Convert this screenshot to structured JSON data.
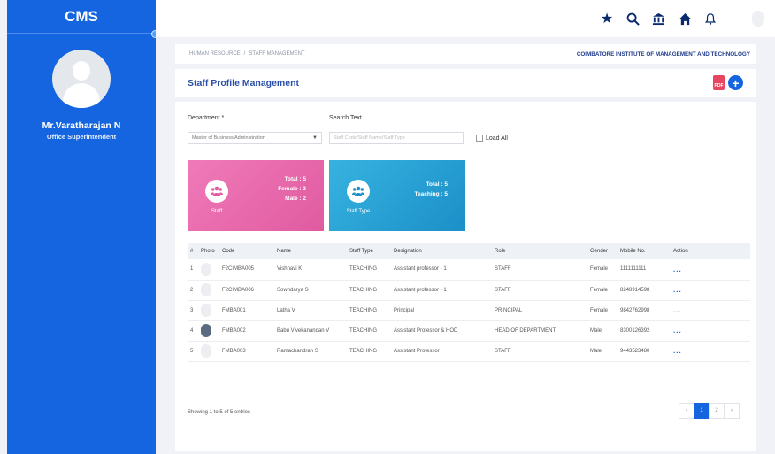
{
  "app": {
    "logo": "CMS"
  },
  "user": {
    "name": "Mr.Varatharajan N",
    "role": "Office Superintendent"
  },
  "topbar_icons": [
    "star-icon",
    "search-icon",
    "bank-icon",
    "home-icon",
    "bell-icon"
  ],
  "breadcrumb": [
    "HUMAN RESOURCE",
    "STAFF MANAGEMENT"
  ],
  "institute": "COIMBATORE INSTITUTE OF MANAGEMENT AND TECHNOLOGY",
  "page_title": "Staff Profile Management",
  "filters": {
    "department_label": "Department *",
    "department_value": "Master of Business Administration",
    "search_label": "Search Text",
    "search_placeholder": "Staff Code/Staff Name/Staff Type",
    "load_all": "Load All"
  },
  "stats": {
    "staff": {
      "caption": "Staff",
      "total": "Total : 5",
      "female": "Female : 3",
      "male": "Male : 2"
    },
    "staff_type": {
      "caption": "Staff Type",
      "total": "Total : 5",
      "teaching": "Teaching : 5"
    }
  },
  "table": {
    "headers": [
      "#",
      "Photo",
      "Code",
      "Name",
      "Staff Type",
      "Designation",
      "Role",
      "Gender",
      "Mobile No.",
      "Action"
    ],
    "rows": [
      [
        "1",
        "",
        "F2CIMBA005",
        "Vishnavi K",
        "TEACHING",
        "Assistant professor - 1",
        "STAFF",
        "Female",
        "1111111111",
        "..."
      ],
      [
        "2",
        "",
        "F2CIMBA006",
        "Sowndarya S",
        "TEACHING",
        "Assistant professor - 1",
        "STAFF",
        "Female",
        "8248914598",
        "..."
      ],
      [
        "3",
        "",
        "FMBA001",
        "Latha V",
        "TEACHING",
        "Principal",
        "PRINCIPAL",
        "Female",
        "9842762998",
        "..."
      ],
      [
        "4",
        "",
        "FMBA002",
        "Babu Vivekanandan V",
        "TEACHING",
        "Assistant Professor & HOD",
        "HEAD OF DEPARTMENT",
        "Male",
        "8300126392",
        "..."
      ],
      [
        "5",
        "",
        "FMBA003",
        "Ramachandran S",
        "TEACHING",
        "Assistant Professor",
        "STAFF",
        "Male",
        "9443523480",
        "..."
      ]
    ]
  },
  "footer": {
    "entries": "Showing 1 to 5 of 5 entries"
  },
  "pagination": {
    "prev": "‹",
    "pages": [
      "1",
      "2"
    ],
    "next": "›"
  }
}
